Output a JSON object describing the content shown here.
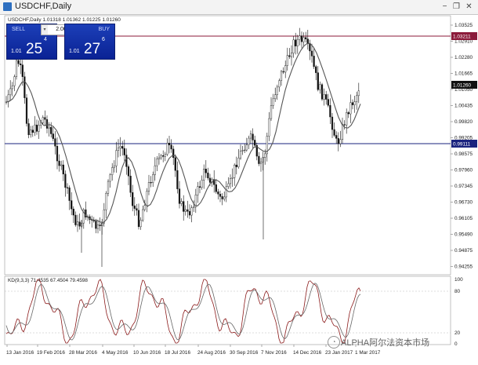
{
  "window": {
    "title": "USDCHF,Daily",
    "minimize_glyph": "−",
    "restore_glyph": "❐",
    "close_glyph": "✕"
  },
  "header_info": "USDCHF,Daily  1.01318 1.01362 1.01225 1.01260",
  "trade_panel": {
    "sell_label": "SELL",
    "buy_label": "BUY",
    "lot": "2.00",
    "sell_prefix": "1.01",
    "sell_big": "25",
    "sell_sup": "4",
    "buy_prefix": "1.01",
    "buy_big": "27",
    "buy_sup": "6"
  },
  "price_axis": {
    "ticks": [
      "1.03525",
      "1.02910",
      "1.02280",
      "1.01665",
      "1.01050",
      "1.00435",
      "0.99820",
      "0.99205",
      "0.98575",
      "0.97960",
      "0.97345",
      "0.96730",
      "0.96105",
      "0.95490",
      "0.94875",
      "0.94255"
    ],
    "current_price": "1.01260",
    "upper_level": "1.03211",
    "lower_level": "0.99111"
  },
  "indicator": {
    "label": "KD(9,3,3) 71.4535 67.4504 79.4598",
    "ticks": [
      "100",
      "80",
      "20",
      "0"
    ]
  },
  "time_axis": {
    "labels": [
      "13 Jan 2016",
      "19 Feb 2016",
      "28 Mar 2016",
      "4 May 2016",
      "10 Jun 2016",
      "18 Jul 2016",
      "24 Aug 2016",
      "30 Sep 2016",
      "7 Nov 2016",
      "14 Dec 2016",
      "23 Jan 2017",
      "1 Mar 2017"
    ]
  },
  "watermark": "ALPHA阿尔法资本市场",
  "colors": {
    "upper_line": "#8b1a3a",
    "lower_line": "#1a237e",
    "candles": "#111111",
    "ma_line": "#555555",
    "kd_k": "#8b1a1a",
    "kd_d": "#666666",
    "panel_blue": "#0a2294"
  }
}
